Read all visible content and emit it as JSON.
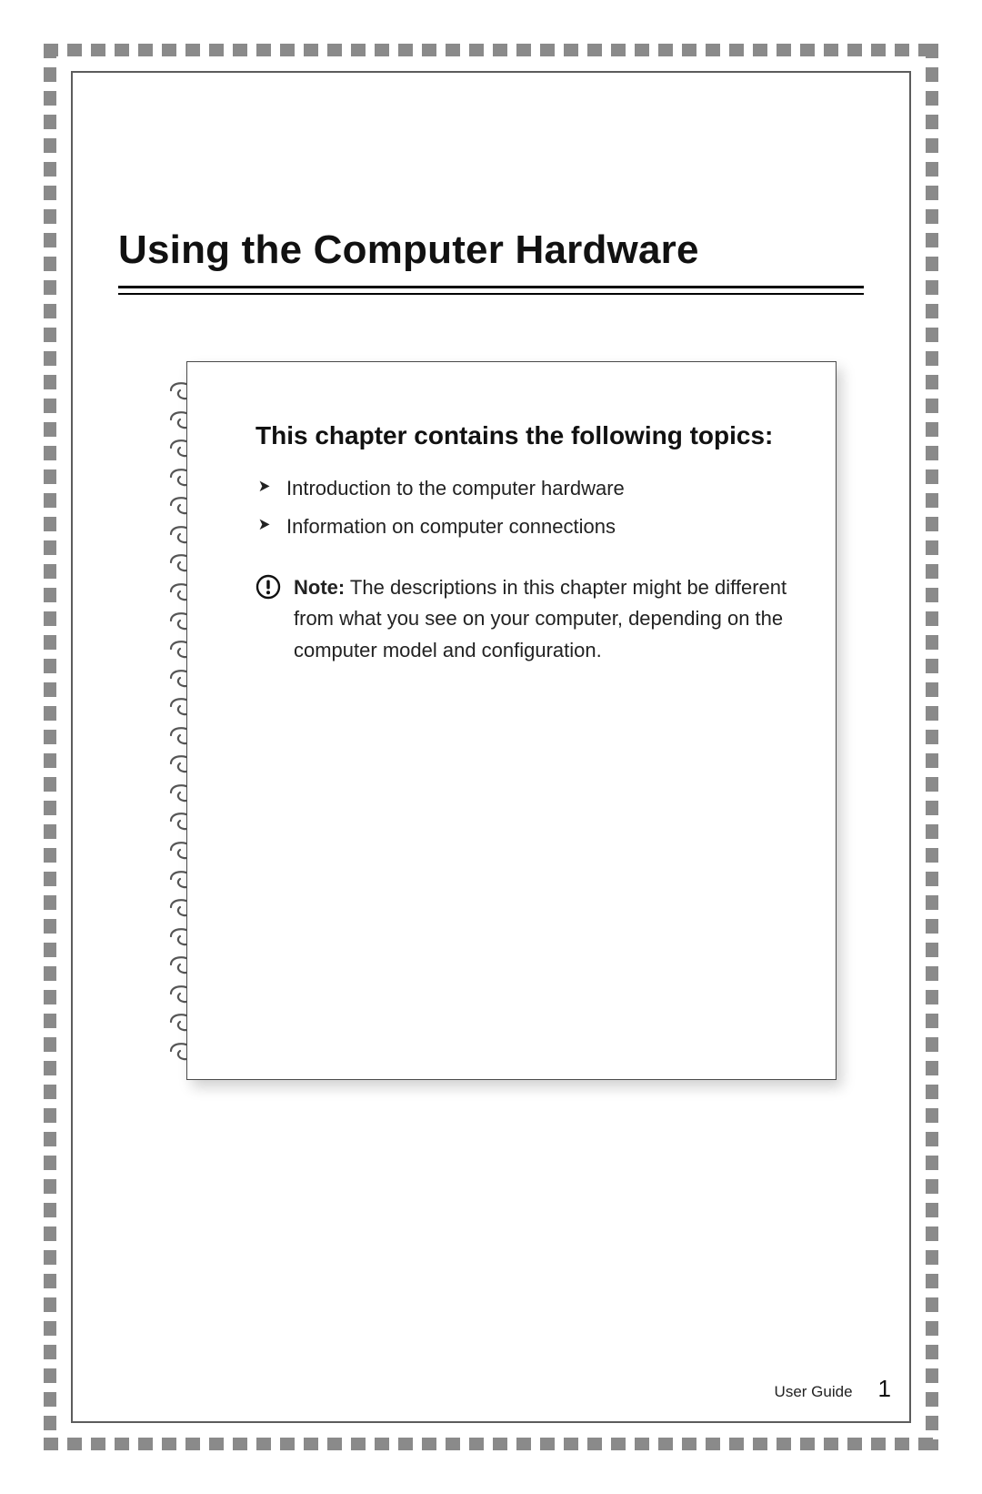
{
  "chapter": {
    "title": "Using the Computer Hardware"
  },
  "topics": {
    "heading": "This chapter contains the following topics:",
    "items": [
      "Introduction to the computer hardware",
      "Information on computer connections"
    ]
  },
  "note": {
    "label": "Note:",
    "body": " The descriptions in this chapter might be different from what you see on your computer, depending on the computer model and configuration."
  },
  "footer": {
    "label": "User Guide",
    "page_number": "1"
  }
}
